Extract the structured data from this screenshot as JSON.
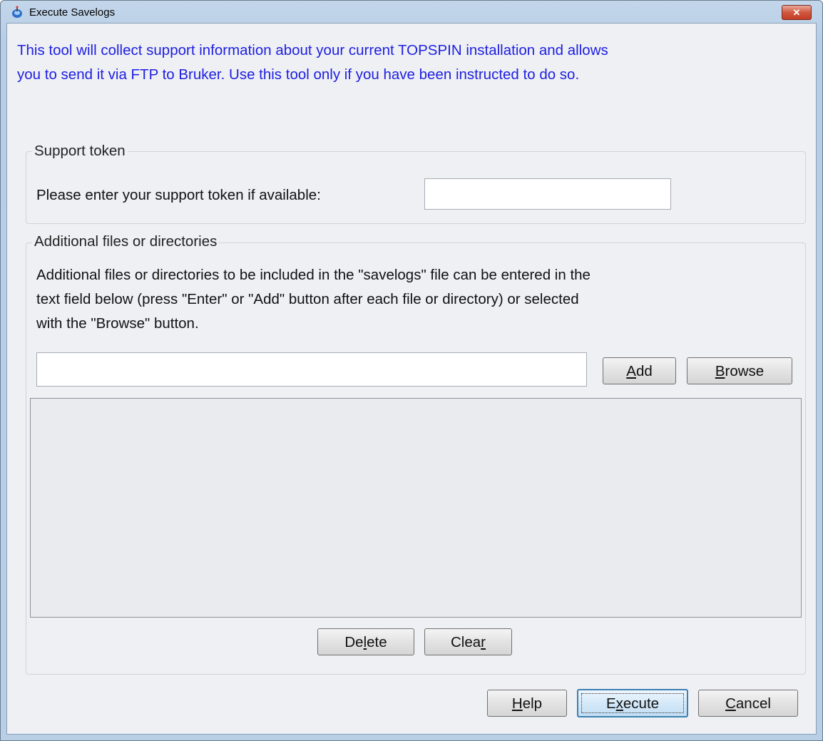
{
  "window": {
    "title": "Execute Savelogs",
    "close_label": "✕"
  },
  "intro": {
    "line1": "This tool will collect support information about your current TOPSPIN installation and allows",
    "line2": "you to send it via FTP to Bruker. Use this tool only if you have been instructed to do so."
  },
  "support_token": {
    "group_title": "Support token",
    "label": "Please enter your support token if available:",
    "value": ""
  },
  "additional": {
    "group_title": "Additional files or directories",
    "desc_line1": "Additional files or directories to be included in the \"savelogs\" file can be entered in the",
    "desc_line2": "text field below (press \"Enter\" or \"Add\" button after each file or directory) or selected",
    "desc_line3": "with the \"Browse\" button.",
    "path_value": "",
    "add": {
      "pre": "",
      "mn": "A",
      "post": "dd"
    },
    "browse": {
      "pre": "",
      "mn": "B",
      "post": "rowse"
    },
    "delete": {
      "pre": "De",
      "mn": "l",
      "post": "ete"
    },
    "clear": {
      "pre": "Clea",
      "mn": "r",
      "post": ""
    },
    "files": []
  },
  "footer": {
    "help": {
      "pre": "",
      "mn": "H",
      "post": "elp"
    },
    "execute": {
      "pre": "E",
      "mn": "x",
      "post": "ecute"
    },
    "cancel": {
      "pre": "",
      "mn": "C",
      "post": "ancel"
    }
  },
  "colors": {
    "intro_text": "#2020e0",
    "close_button": "#c43c22",
    "focus_border": "#3c7fb1"
  }
}
